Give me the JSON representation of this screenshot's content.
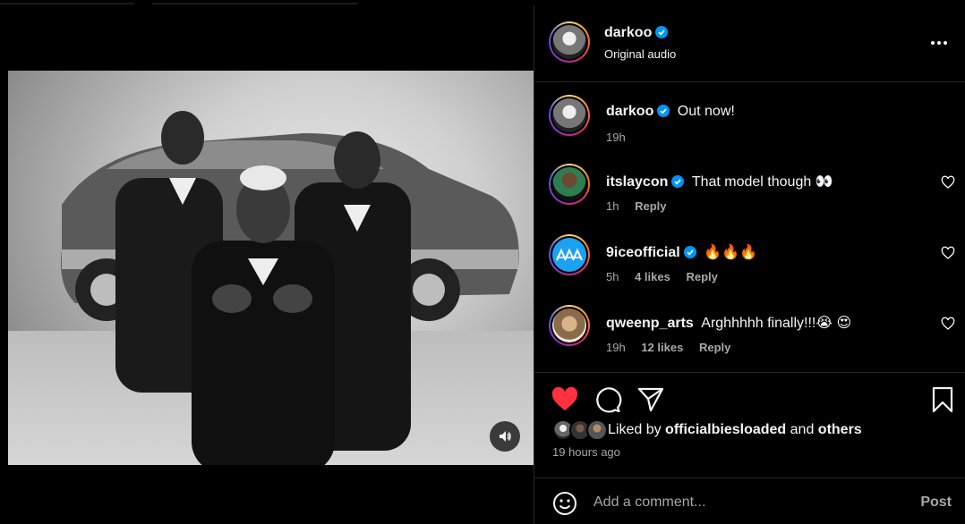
{
  "header": {
    "username": "darkoo",
    "subtitle": "Original audio"
  },
  "caption": {
    "username": "darkoo",
    "text": "Out now!",
    "time": "19h"
  },
  "comments": [
    {
      "username": "itslaycon",
      "verified": true,
      "text": "That model though 👀",
      "time": "1h",
      "likes": "",
      "reply": "Reply"
    },
    {
      "username": "9iceofficial",
      "verified": true,
      "text": "🔥🔥🔥",
      "time": "5h",
      "likes": "4 likes",
      "reply": "Reply"
    },
    {
      "username": "qweenp_arts",
      "verified": false,
      "text": "Arghhhhh finally!!!😭 😍",
      "time": "19h",
      "likes": "12 likes",
      "reply": "Reply"
    }
  ],
  "likes": {
    "prefix": "Liked by",
    "user": "officialbiesloaded",
    "and": "and",
    "others": "others"
  },
  "post_time": "19 hours ago",
  "comment_box": {
    "placeholder": "Add a comment...",
    "post_label": "Post"
  },
  "icons": {
    "verified": "verified-badge-icon",
    "more": "more-horizontal-icon",
    "like": "heart-filled-icon",
    "comment": "comment-bubble-icon",
    "share": "paper-plane-icon",
    "save": "bookmark-icon",
    "emoji": "smiley-icon",
    "mute": "speaker-icon"
  },
  "colors": {
    "background": "#000000",
    "text": "#f5f5f5",
    "muted": "#a8a8a8",
    "like_red": "#ff3040",
    "verified_blue": "#0095f6",
    "divider": "#262626"
  }
}
